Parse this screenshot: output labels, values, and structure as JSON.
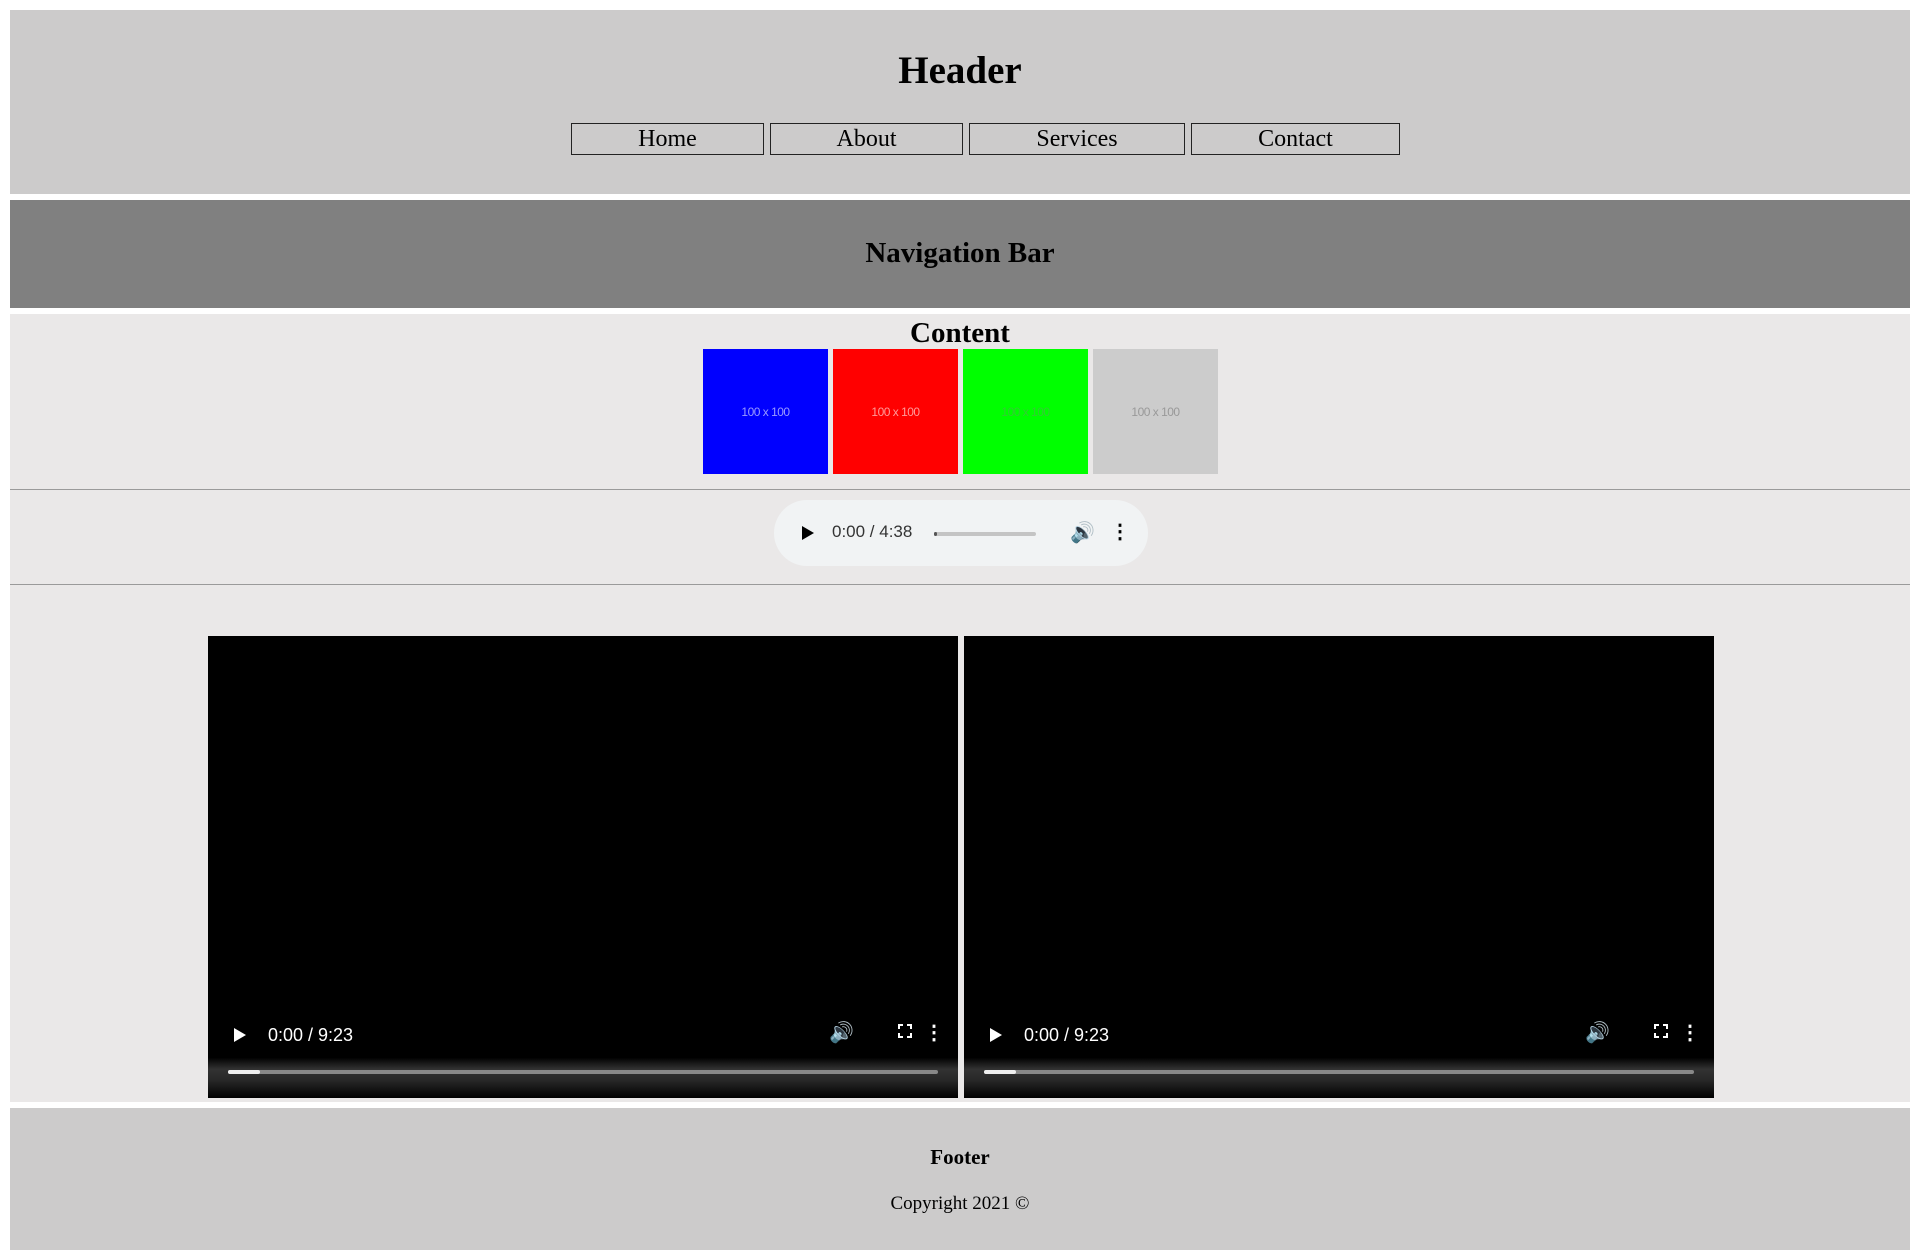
{
  "header": {
    "title": "Header",
    "nav": [
      "Home",
      "About",
      "Services",
      "Contact"
    ]
  },
  "navbar": {
    "title": "Navigation Bar"
  },
  "content": {
    "title": "Content",
    "thumbnails": [
      {
        "label": "100 x 100",
        "color": "#0000ff"
      },
      {
        "label": "100 x 100",
        "color": "#ff0000"
      },
      {
        "label": "100 x 100",
        "color": "#00ff00"
      },
      {
        "label": "100 x 100",
        "color": "#cccccc"
      }
    ],
    "audio": {
      "time": "0:00 / 4:38",
      "icons": {
        "play": "play-icon",
        "volume": "volume-icon",
        "more": "more-options-icon"
      }
    },
    "videos": [
      {
        "time": "0:00 / 9:23"
      },
      {
        "time": "0:00 / 9:23"
      }
    ]
  },
  "footer": {
    "title": "Footer",
    "copyright": "Copyright 2021 ©"
  },
  "colors": {
    "header_bg": "#cccbcb",
    "navbar_bg": "#808080",
    "content_bg": "#eae8e8",
    "footer_bg": "#cccbcb"
  }
}
